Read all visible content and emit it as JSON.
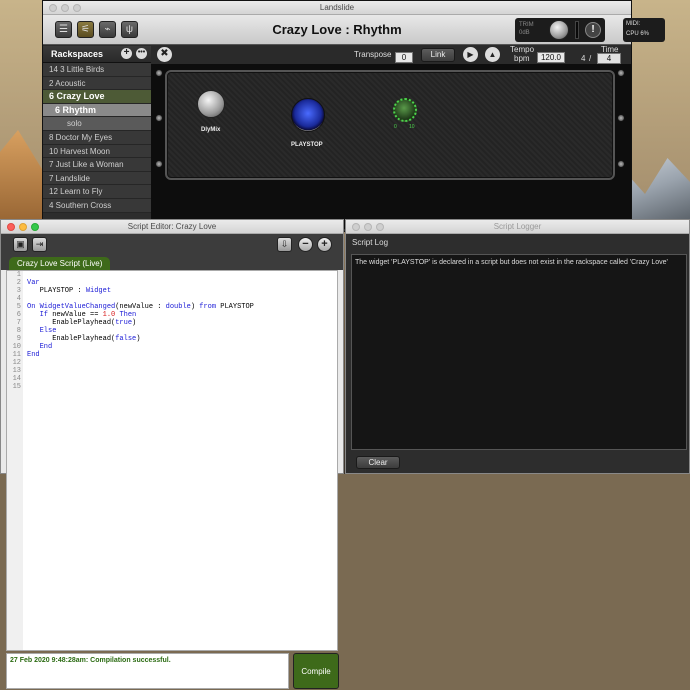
{
  "main_window": {
    "title": "Landslide",
    "song_title": "Crazy Love : Rhythm",
    "trim_label": "TRIM",
    "trim_value": "0dB",
    "midi_label": "MIDI:",
    "cpu_label": "CPU",
    "cpu_value": "6%",
    "transpose_label": "Transpose",
    "transpose_value": "0",
    "link_label": "Link",
    "tempo_label": "Tempo",
    "bpm_label": "bpm",
    "tempo_value": "120.0",
    "time_label": "Time",
    "time_num": "4",
    "time_sep": "/",
    "time_den": "4"
  },
  "rackspaces": {
    "title": "Rackspaces",
    "items": [
      {
        "label": "14 3 Little Birds",
        "type": "normal"
      },
      {
        "label": "2 Acoustic",
        "type": "normal"
      },
      {
        "label": "6 Crazy Love",
        "type": "active"
      },
      {
        "label": "6  Rhythm",
        "type": "selected-sub"
      },
      {
        "label": "solo",
        "type": "sub"
      },
      {
        "label": "8 Doctor My Eyes",
        "type": "normal"
      },
      {
        "label": "10 Harvest Moon",
        "type": "normal"
      },
      {
        "label": "7 Just Like a Woman",
        "type": "normal"
      },
      {
        "label": "7 Landslide",
        "type": "normal"
      },
      {
        "label": "12 Learn to Fly",
        "type": "normal"
      },
      {
        "label": "4 Southern Cross",
        "type": "normal"
      }
    ]
  },
  "rack_panel": {
    "widgets": {
      "knob_label": "DlyMix",
      "playstop_label": "PLAYSTOP",
      "green_knob_min": "0",
      "green_knob_max": "10"
    }
  },
  "script_editor": {
    "title": "Script Editor:  Crazy Love",
    "tab_label": "Crazy Love Script (Live)",
    "line_numbers": [
      "1",
      "2",
      "3",
      "4",
      "5",
      "6",
      "7",
      "8",
      "9",
      "10",
      "11",
      "12",
      "13",
      "14",
      "15"
    ],
    "status_text": "27 Feb 2020 9:48:28am: Compilation successful.",
    "compile_label": "Compile"
  },
  "script_logger": {
    "title": "Script Logger",
    "log_title": "Script Log",
    "log_text": "The widget 'PLAYSTOP' is declared in a script but does not exist in the rackspace called 'Crazy Love'",
    "clear_label": "Clear"
  }
}
